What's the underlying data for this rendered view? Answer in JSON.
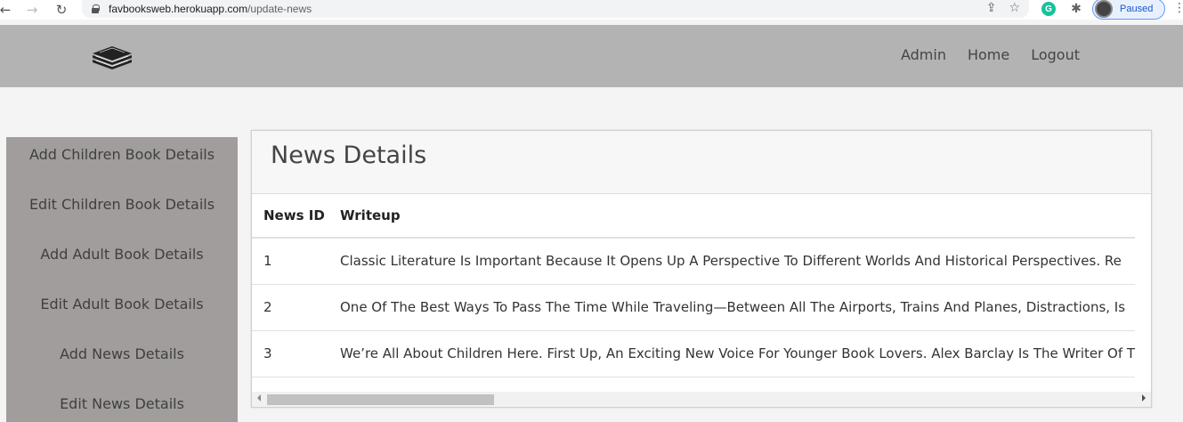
{
  "browser": {
    "back_icon": "←",
    "forward_icon": "→",
    "reload_icon": "↻",
    "url_host": "favbooksweb.herokuapp.com",
    "url_path": "/update-news",
    "share_icon": "⇪",
    "star_icon": "☆",
    "grammarly_icon": "G",
    "extensions_icon": "✱",
    "profile_status": "Paused",
    "menu_icon": "⋮"
  },
  "header": {
    "nav": [
      "Admin",
      "Home",
      "Logout"
    ]
  },
  "sidebar": {
    "items": [
      "Add Children Book Details",
      "Edit Children Book Details",
      "Add Adult Book Details",
      "Edit Adult Book Details",
      "Add News Details",
      "Edit News Details"
    ]
  },
  "main": {
    "title": "News Details",
    "table": {
      "columns": [
        "News ID",
        "Writeup"
      ],
      "rows": [
        [
          "1",
          "Classic Literature Is Important Because It Opens Up A Perspective To Different Worlds And Historical Perspectives. Re"
        ],
        [
          "2",
          "One Of The Best Ways To Pass The Time While Traveling—Between All The Airports, Trains And Planes, Distractions, Is"
        ],
        [
          "3",
          "We’re All About Children Here. First Up, An Exciting New Voice For Younger Book Lovers. Alex Barclay Is The Writer Of T"
        ]
      ]
    }
  },
  "colors": {
    "header_bg": "#b3b3b3",
    "sidebar_bg": "#a19d9d",
    "page_bg": "#f4f4f4"
  }
}
